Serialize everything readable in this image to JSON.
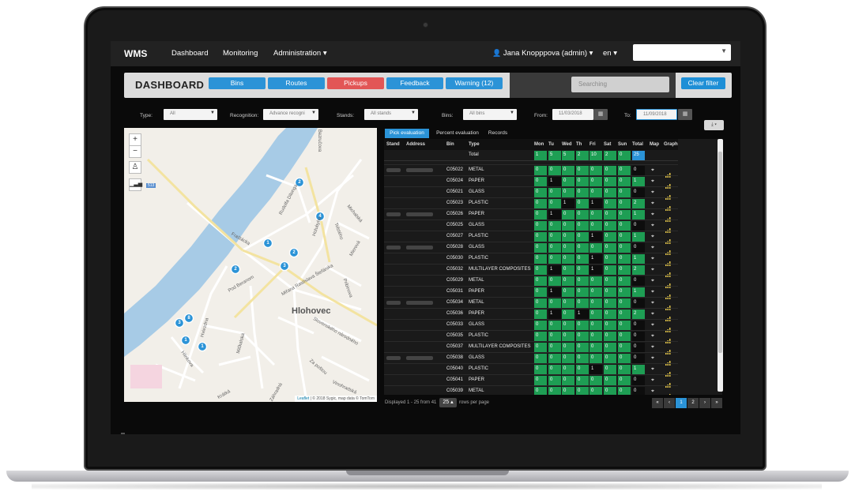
{
  "navbar": {
    "brand": "WMS",
    "items": [
      "Dashboard",
      "Monitoring",
      "Administration ▾"
    ],
    "user": "Jana Knopppova (admin) ▾",
    "lang": "en ▾"
  },
  "toolbar": {
    "title": "DASHBOARD",
    "buttons": [
      {
        "label": "Bins",
        "color": "#2b93d7"
      },
      {
        "label": "Routes",
        "color": "#2b93d7"
      },
      {
        "label": "Pickups",
        "color": "#e25656"
      },
      {
        "label": "Feedback",
        "color": "#2b93d7"
      },
      {
        "label": "Warning (12)",
        "color": "#2b93d7"
      }
    ],
    "search_placeholder": "Searching",
    "clear_label": "Clear filter"
  },
  "filters": {
    "type_label": "Type:",
    "type_value": "All",
    "recognition_label": "Recognition:",
    "recognition_value": "Advance recogni",
    "stands_label": "Stands:",
    "stands_value": "All stands",
    "bins_label": "Bins:",
    "bins_value": "All bins",
    "from_label": "From:",
    "from_value": "11/03/2018",
    "to_label": "To:",
    "to_value": "11/09/2018"
  },
  "map": {
    "town": "Hlohovec",
    "attribution_link": "Leaflet",
    "attribution_text": "| © 2018 Sygic, map data © TomTom",
    "road_number": "513",
    "streets": [
      "Fraštácka",
      "Rudolfa Dilonga",
      "Holubyho",
      "Tolstého",
      "Mierová",
      "Pod Beranom",
      "Miřana Rastislava Štefánika",
      "Pribinova",
      "Slovenského národného",
      "Za poštou",
      "Mičkalská",
      "Hviezdna",
      "Hlinkova",
      "Vinohradská",
      "Záhradná",
      "Bezručova",
      "Michalská",
      "Krátká"
    ],
    "markers": [
      "2",
      "4",
      "1",
      "2",
      "3",
      "2",
      "3",
      "8",
      "1",
      "1"
    ]
  },
  "tabs": [
    "Pick evaluation",
    "Percent evaluation",
    "Records"
  ],
  "grid": {
    "headers": [
      "Stand",
      "Address",
      "Bin",
      "Type",
      "Mon",
      "Tu",
      "Wed",
      "Th",
      "Fri",
      "Sat",
      "Sun",
      "Total",
      "Map",
      "Graph"
    ],
    "total_row": {
      "label": "Total",
      "days": [
        "1",
        "5",
        "5",
        "2",
        "10",
        "2",
        "0"
      ],
      "total": "25"
    },
    "rows": [
      {
        "bin": "C05022",
        "type": "METAL",
        "days": [
          "0",
          "0",
          "0",
          "0",
          "0",
          "0",
          "0"
        ],
        "total": "0"
      },
      {
        "bin": "C05024",
        "type": "PAPER",
        "days": [
          "0",
          "1",
          "0",
          "0",
          "0",
          "0",
          "0"
        ],
        "total": "1"
      },
      {
        "bin": "C05021",
        "type": "GLASS",
        "days": [
          "0",
          "0",
          "0",
          "0",
          "0",
          "0",
          "0"
        ],
        "total": "0"
      },
      {
        "bin": "C05023",
        "type": "PLASTIC",
        "days": [
          "0",
          "0",
          "1",
          "0",
          "1",
          "0",
          "0"
        ],
        "total": "2"
      },
      {
        "bin": "C05026",
        "type": "PAPER",
        "days": [
          "0",
          "1",
          "0",
          "0",
          "0",
          "0",
          "0"
        ],
        "total": "1"
      },
      {
        "bin": "C05025",
        "type": "GLASS",
        "days": [
          "0",
          "0",
          "0",
          "0",
          "0",
          "0",
          "0"
        ],
        "total": "0"
      },
      {
        "bin": "C05027",
        "type": "PLASTIC",
        "days": [
          "0",
          "0",
          "0",
          "0",
          "1",
          "0",
          "0"
        ],
        "total": "1"
      },
      {
        "bin": "C05028",
        "type": "GLASS",
        "days": [
          "0",
          "0",
          "0",
          "0",
          "0",
          "0",
          "0"
        ],
        "total": "0"
      },
      {
        "bin": "C05030",
        "type": "PLASTIC",
        "days": [
          "0",
          "0",
          "0",
          "0",
          "1",
          "0",
          "0"
        ],
        "total": "1"
      },
      {
        "bin": "C05032",
        "type": "MULTILAYER COMPOSITES",
        "days": [
          "0",
          "1",
          "0",
          "0",
          "1",
          "0",
          "0"
        ],
        "total": "2"
      },
      {
        "bin": "C05029",
        "type": "METAL",
        "days": [
          "0",
          "0",
          "0",
          "0",
          "0",
          "0",
          "0"
        ],
        "total": "0"
      },
      {
        "bin": "C05031",
        "type": "PAPER",
        "days": [
          "0",
          "1",
          "0",
          "0",
          "0",
          "0",
          "0"
        ],
        "total": "1"
      },
      {
        "bin": "C05034",
        "type": "METAL",
        "days": [
          "0",
          "0",
          "0",
          "0",
          "0",
          "0",
          "0"
        ],
        "total": "0"
      },
      {
        "bin": "C05036",
        "type": "PAPER",
        "days": [
          "0",
          "1",
          "0",
          "1",
          "0",
          "0",
          "0"
        ],
        "total": "2"
      },
      {
        "bin": "C05033",
        "type": "GLASS",
        "days": [
          "0",
          "0",
          "0",
          "0",
          "0",
          "0",
          "0"
        ],
        "total": "0"
      },
      {
        "bin": "C05035",
        "type": "PLASTIC",
        "days": [
          "0",
          "0",
          "0",
          "0",
          "0",
          "0",
          "0"
        ],
        "total": "0"
      },
      {
        "bin": "C05037",
        "type": "MULTILAYER COMPOSITES",
        "days": [
          "0",
          "0",
          "0",
          "0",
          "0",
          "0",
          "0"
        ],
        "total": "0"
      },
      {
        "bin": "C05038",
        "type": "GLASS",
        "days": [
          "0",
          "0",
          "0",
          "0",
          "0",
          "0",
          "0"
        ],
        "total": "0"
      },
      {
        "bin": "C05040",
        "type": "PLASTIC",
        "days": [
          "0",
          "0",
          "0",
          "0",
          "1",
          "0",
          "0"
        ],
        "total": "1"
      },
      {
        "bin": "C05041",
        "type": "PAPER",
        "days": [
          "0",
          "0",
          "0",
          "0",
          "0",
          "0",
          "0"
        ],
        "total": "0"
      },
      {
        "bin": "C05039",
        "type": "METAL",
        "days": [
          "0",
          "0",
          "0",
          "0",
          "0",
          "0",
          "0"
        ],
        "total": "0"
      }
    ],
    "stand_group_rows": [
      0,
      4,
      7,
      12,
      17
    ]
  },
  "footer": {
    "displayed": "Displayed 1 - 25 from 41",
    "page_size": "25 ▴",
    "rows_per_page": "rows per page",
    "pages": [
      "«",
      "‹",
      "1",
      "2",
      "›",
      "»"
    ],
    "active_page": "1"
  },
  "colors": {
    "green": "#1e9e54",
    "black": "#0d0d0d",
    "blue": "#2b93d7",
    "red": "#e25656"
  }
}
